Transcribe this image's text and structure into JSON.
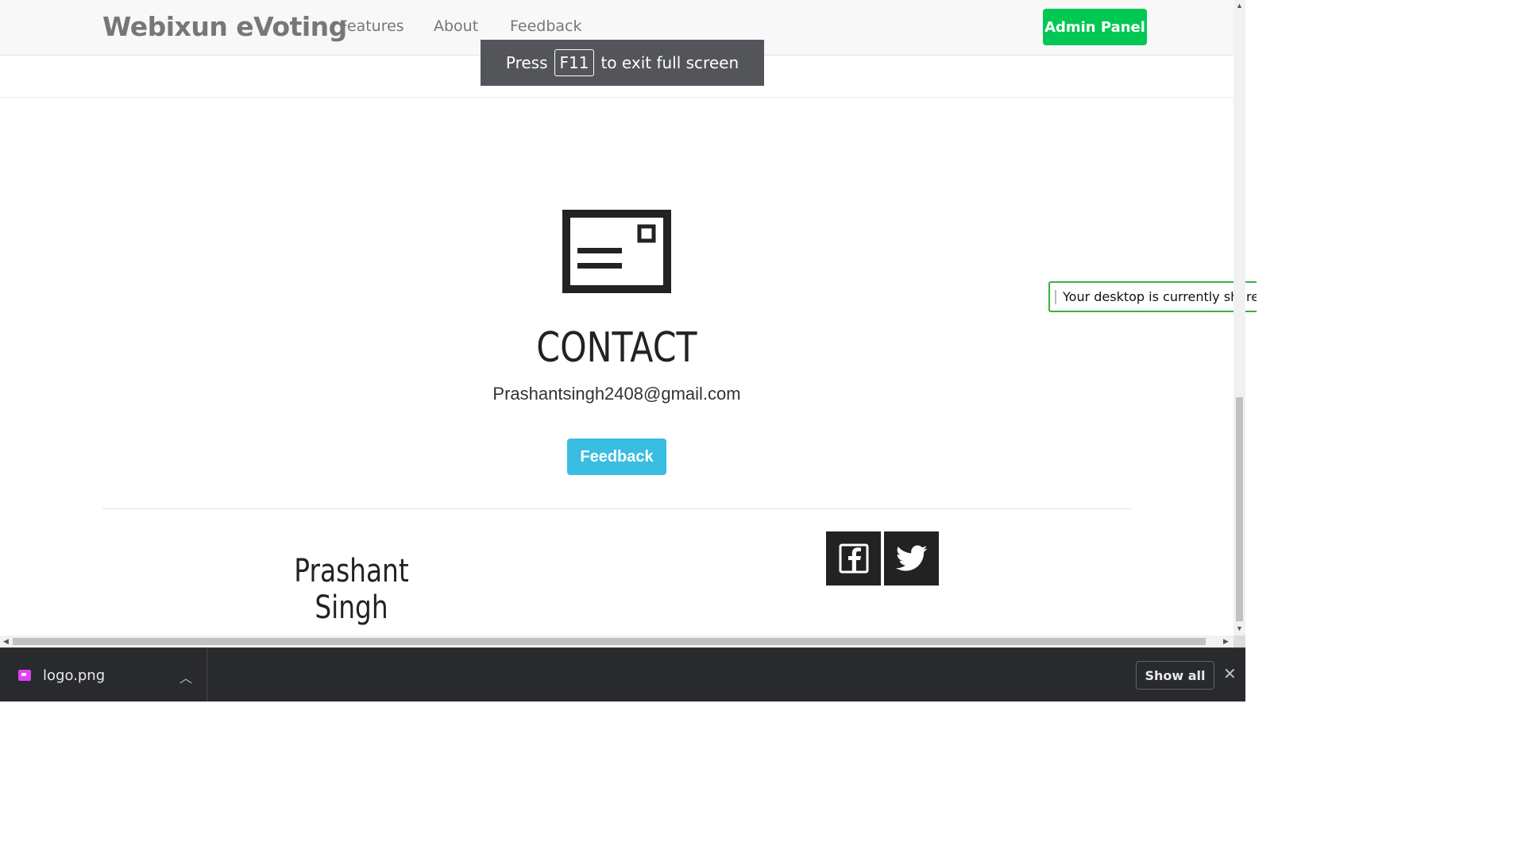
{
  "navbar": {
    "brand": "Webixun eVoting",
    "links": [
      "Features",
      "About",
      "Feedback"
    ],
    "admin_button": "Admin Panel"
  },
  "fullscreen_toast": {
    "prefix": "Press",
    "key": "F11",
    "suffix": "to exit full screen"
  },
  "contact": {
    "title": "CONTACT",
    "email": "Prashantsingh2408@gmail.com",
    "feedback_button": "Feedback"
  },
  "footer": {
    "author_line1": "Prashant",
    "author_line2": "Singh",
    "social_icons": [
      "facebook-icon",
      "twitter-icon"
    ]
  },
  "share_notice": {
    "text": "Your desktop is currently shared"
  },
  "download_shelf": {
    "file_name": "logo.png",
    "show_all": "Show all"
  },
  "colors": {
    "admin_green": "#00c853",
    "feedback_blue": "#39bde1",
    "toast_bg": "#53555a",
    "shelf_bg": "#292a2d",
    "share_border": "#3cb043"
  }
}
